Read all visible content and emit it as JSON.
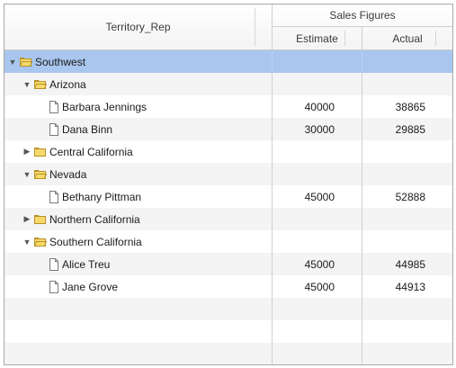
{
  "header": {
    "territory_rep": "Territory_Rep",
    "sales_figures": "Sales Figures",
    "estimate": "Estimate",
    "actual": "Actual"
  },
  "rows": [
    {
      "label": "Southwest",
      "type": "folder",
      "expanded": true,
      "level": 0,
      "estimate": "",
      "actual": ""
    },
    {
      "label": "Arizona",
      "type": "folder",
      "expanded": true,
      "level": 1,
      "estimate": "",
      "actual": ""
    },
    {
      "label": "Barbara Jennings",
      "type": "leaf",
      "level": 2,
      "estimate": "40000",
      "actual": "38865"
    },
    {
      "label": "Dana Binn",
      "type": "leaf",
      "level": 2,
      "estimate": "30000",
      "actual": "29885"
    },
    {
      "label": "Central California",
      "type": "folder",
      "expanded": false,
      "level": 1,
      "estimate": "",
      "actual": ""
    },
    {
      "label": "Nevada",
      "type": "folder",
      "expanded": true,
      "level": 1,
      "estimate": "",
      "actual": ""
    },
    {
      "label": "Bethany Pittman",
      "type": "leaf",
      "level": 2,
      "estimate": "45000",
      "actual": "52888"
    },
    {
      "label": "Northern California",
      "type": "folder",
      "expanded": false,
      "level": 1,
      "estimate": "",
      "actual": ""
    },
    {
      "label": "Southern California",
      "type": "folder",
      "expanded": true,
      "level": 1,
      "estimate": "",
      "actual": ""
    },
    {
      "label": "Alice Treu",
      "type": "leaf",
      "level": 2,
      "estimate": "45000",
      "actual": "44985"
    },
    {
      "label": "Jane Grove",
      "type": "leaf",
      "level": 2,
      "estimate": "45000",
      "actual": "44913"
    }
  ],
  "selected_row": 0,
  "empty_rows": 3,
  "colors": {
    "selected": "#a9c6ee",
    "stripe": "#f4f4f4",
    "folder_fill": "#f7d96a",
    "folder_stroke": "#b8922a"
  }
}
